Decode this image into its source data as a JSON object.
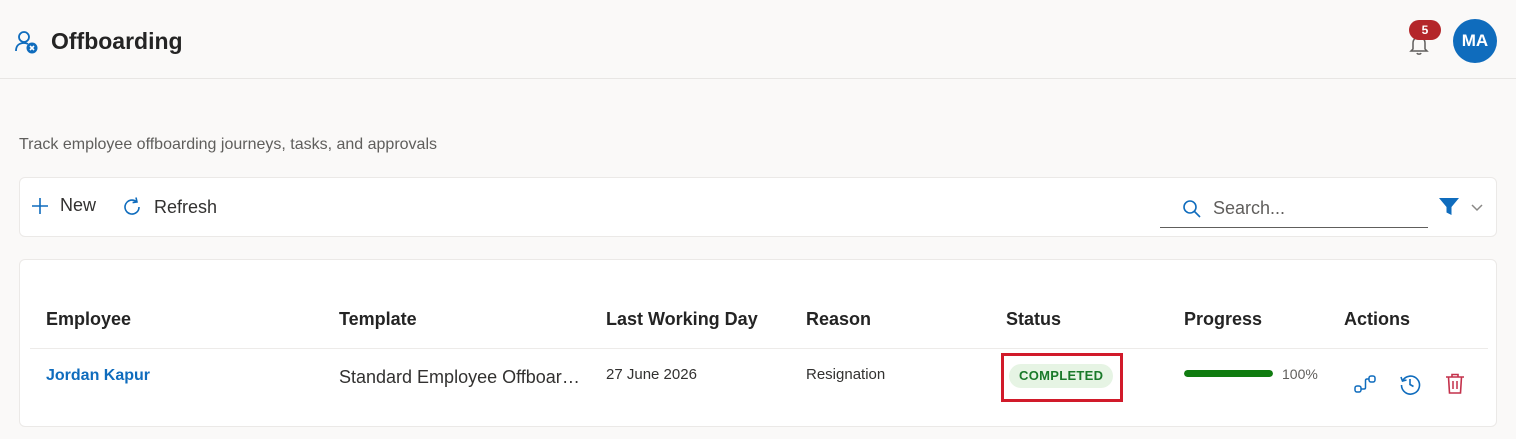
{
  "header": {
    "title": "Offboarding",
    "notifications_count": "5",
    "avatar_initials": "MA",
    "app_icon": "person-remove-icon",
    "bell_icon": "bell-icon"
  },
  "subtitle": "Track employee offboarding journeys, tasks, and approvals",
  "toolbar": {
    "new_label": "New",
    "refresh_label": "Refresh",
    "search_placeholder": "Search...",
    "search_value": ""
  },
  "table": {
    "columns": [
      "Employee",
      "Template",
      "Last Working Day",
      "Reason",
      "Status",
      "Progress",
      "Actions"
    ],
    "rows": [
      {
        "employee": "Jordan Kapur",
        "template": "Standard Employee Offboarding",
        "last_working_day": "27 June 2026",
        "reason": "Resignation",
        "status": "COMPLETED",
        "progress": 100,
        "progress_label": "100%"
      }
    ]
  },
  "colors": {
    "accent": "#0f6cbd",
    "badge": "#b4262a",
    "status_completed_bg": "#e6f4e4",
    "status_completed_text": "#1a7a2a",
    "progress": "#107c10",
    "highlight_box": "#d11a2a",
    "delete": "#c4314b"
  }
}
